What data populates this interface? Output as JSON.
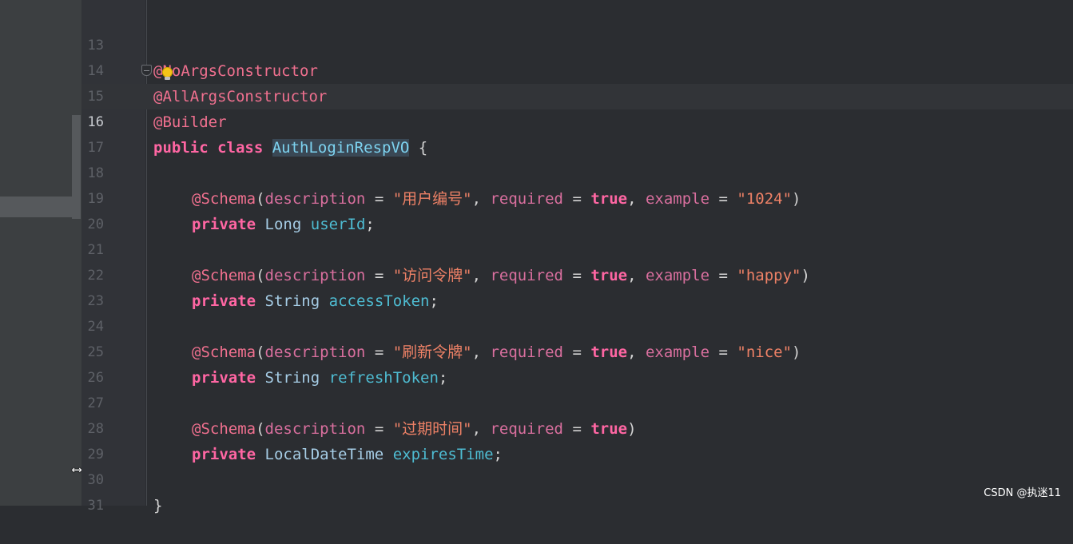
{
  "lines": [
    {
      "n": "13",
      "text": "@NoArgsConstructor"
    },
    {
      "n": "14",
      "text": "@AllArgsConstructor"
    },
    {
      "n": "15",
      "text": "@Builder"
    },
    {
      "n": "16",
      "kw": "public class",
      "cls": "AuthLoginRespVO",
      "brace": "{"
    },
    {
      "n": "17"
    },
    {
      "n": "18",
      "ann": "@Schema",
      "desc_key": "description",
      "desc_val": "\"用户编号\"",
      "req_key": "required",
      "req_val": "true",
      "ex_key": "example",
      "ex_val": "\"1024\""
    },
    {
      "n": "19",
      "mod": "private",
      "type": "Long",
      "field": "userId"
    },
    {
      "n": "20"
    },
    {
      "n": "21",
      "ann": "@Schema",
      "desc_key": "description",
      "desc_val": "\"访问令牌\"",
      "req_key": "required",
      "req_val": "true",
      "ex_key": "example",
      "ex_val": "\"happy\""
    },
    {
      "n": "22",
      "mod": "private",
      "type": "String",
      "field": "accessToken"
    },
    {
      "n": "23"
    },
    {
      "n": "24",
      "ann": "@Schema",
      "desc_key": "description",
      "desc_val": "\"刷新令牌\"",
      "req_key": "required",
      "req_val": "true",
      "ex_key": "example",
      "ex_val": "\"nice\""
    },
    {
      "n": "25",
      "mod": "private",
      "type": "String",
      "field": "refreshToken"
    },
    {
      "n": "26"
    },
    {
      "n": "27",
      "ann": "@Schema",
      "desc_key": "description",
      "desc_val": "\"过期时间\"",
      "req_key": "required",
      "req_val": "true"
    },
    {
      "n": "28",
      "mod": "private",
      "type": "LocalDateTime",
      "field": "expiresTime"
    },
    {
      "n": "29"
    },
    {
      "n": "30",
      "text": "}"
    },
    {
      "n": "31"
    }
  ],
  "watermark": "CSDN @执迷11"
}
